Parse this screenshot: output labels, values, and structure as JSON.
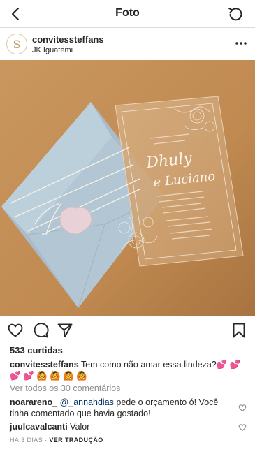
{
  "header": {
    "title": "Foto"
  },
  "post": {
    "username": "convitessteffans",
    "location": "JK Iguatemi",
    "avatar_letter": "S",
    "image": {
      "script_names": "Dhuly e Luciano"
    },
    "likes": "533 curtidas",
    "caption": {
      "username": "convitessteffans",
      "text": "Tem como não amar essa lindeza?💕 💕 💕 💕 🙆 🙆 🙆 🙆"
    },
    "view_all": "Ver todos os 30 comentários",
    "comments": [
      {
        "username": "noarareno_",
        "mention": "@_annahdias",
        "text": "pede o orçamento ó! Você tinha comentado que havia gostado!"
      },
      {
        "username": "juulcavalcanti",
        "mention": "",
        "text": "Valor"
      }
    ],
    "time_ago": "HÁ 3 DIAS",
    "separator": "·",
    "translate": "VER TRADUÇÃO"
  },
  "colors": {
    "text": "#262626",
    "muted": "#8e8e8e",
    "mention": "#003569",
    "kraft_background": "#c58f57",
    "envelope": "#b9ccd6"
  },
  "icons": [
    "chevron-left-icon",
    "refresh-icon",
    "more-dots-icon",
    "heart-icon",
    "comment-icon",
    "share-icon",
    "bookmark-icon"
  ]
}
